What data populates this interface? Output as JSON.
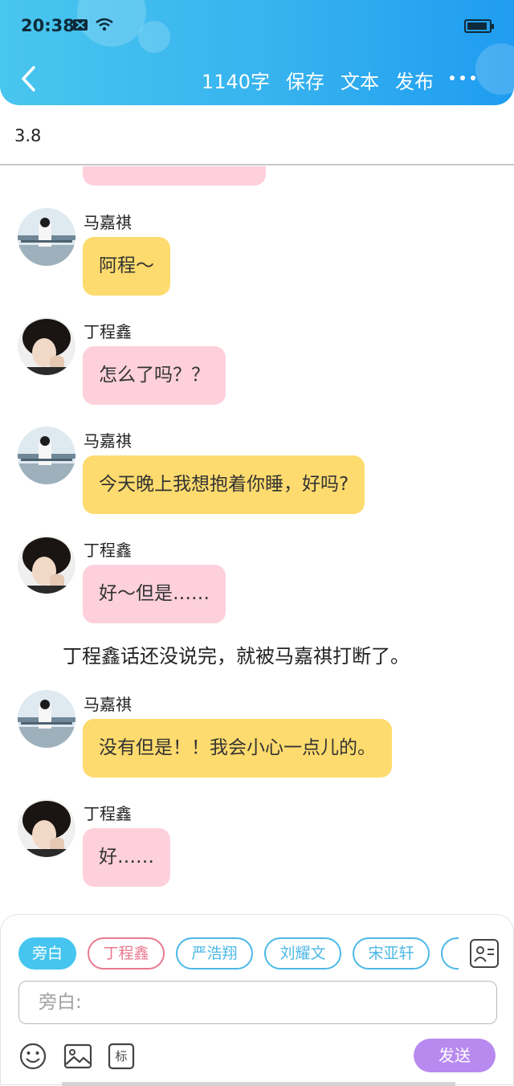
{
  "status_bar": {
    "time": "20:38"
  },
  "toolbar": {
    "word_count": "1140字",
    "save": "保存",
    "text": "文本",
    "publish": "发布"
  },
  "chapter_title": "3.8",
  "messages": [
    {
      "sender": "马嘉祺",
      "text": "阿程～",
      "color": "#fedb6e"
    },
    {
      "sender": "丁程鑫",
      "text": "怎么了吗？？",
      "color": "#fdd0dc"
    },
    {
      "sender": "马嘉祺",
      "text": "今天晚上我想抱着你睡，好吗?",
      "color": "#fedb6e"
    },
    {
      "sender": "丁程鑫",
      "text": "好～但是……",
      "color": "#fdd0dc"
    },
    {
      "sender": "马嘉祺",
      "text": "没有但是！！我会小心一点儿的。",
      "color": "#fedb6e"
    },
    {
      "sender": "丁程鑫",
      "text": "好……",
      "color": "#fdd0dc"
    }
  ],
  "narration": "丁程鑫话还没说完，就被马嘉祺打断了。",
  "role_chips": [
    "旁白",
    "丁程鑫",
    "严浩翔",
    "刘耀文",
    "宋亚轩"
  ],
  "input": {
    "placeholder": "旁白:"
  },
  "tools": {
    "tag_label": "标"
  },
  "send_label": "发送",
  "colors": {
    "header_accent": "#36b2ef",
    "send_button": "#b88af0",
    "chip_active": "#45c5ef"
  }
}
